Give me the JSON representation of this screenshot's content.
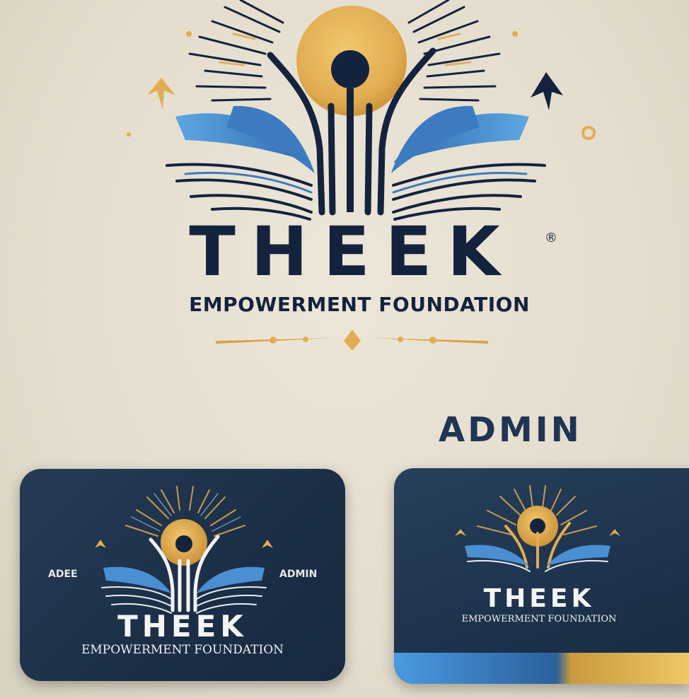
{
  "brand": {
    "name": "THEEK",
    "tagline": "EMPOWERMENT FOUNDATION",
    "registered_mark": "®"
  },
  "admin_label": "ADMIN",
  "cards": [
    {
      "left_text": "ADEE",
      "right_text": "ADMIN",
      "title": "THEEK",
      "subtitle": "EMPOWERMENT FOUNDATION"
    },
    {
      "title": "THEEK",
      "subtitle": "EMPOWERMENT FOUNDATION"
    }
  ],
  "colors": {
    "navy": "#14233d",
    "gold": "#e2ad52",
    "blue": "#4a8fd1",
    "background": "#e8e2d4"
  },
  "icons": [
    "sun-icon",
    "open-book-icon",
    "raised-arms-icon",
    "arrow-up-icon",
    "sparkle-icon"
  ]
}
